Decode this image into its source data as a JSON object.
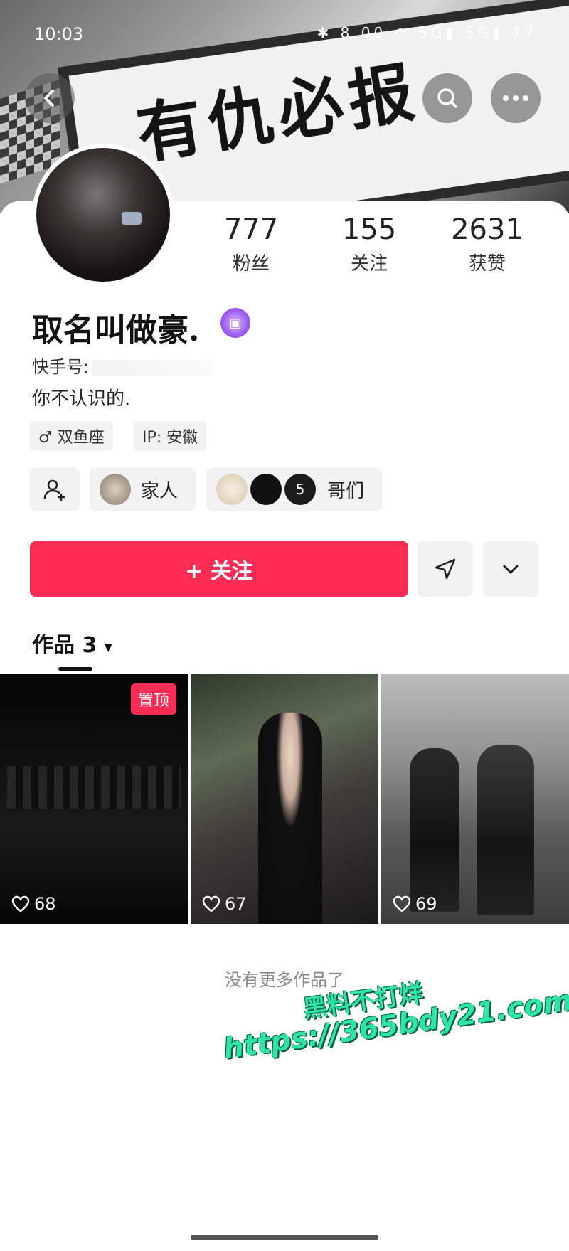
{
  "status_bar": {
    "time": "10:03",
    "icons": "✱ 8.00 ◠ 5G▮ 5G▮ 77"
  },
  "header": {
    "back_icon": "chevron-left-icon",
    "search_icon": "search-icon",
    "more_icon": "more-icon",
    "banner_text": "有仇必报"
  },
  "stats": [
    {
      "value": "777",
      "label": "粉丝"
    },
    {
      "value": "155",
      "label": "关注"
    },
    {
      "value": "2631",
      "label": "获赞"
    }
  ],
  "profile": {
    "name": "取名叫做豪.",
    "id_label": "快手号:",
    "bio": "你不认识的.",
    "tags": [
      "♂ 双鱼座",
      "IP: 安徽"
    ]
  },
  "relations": {
    "family_label": "家人",
    "bros_count": "5",
    "bros_label": "哥们"
  },
  "actions": {
    "follow_label": "+ 关注"
  },
  "works": {
    "title": "作品 3",
    "caret": "▾"
  },
  "posts": [
    {
      "likes": "68",
      "pinned_label": "置顶"
    },
    {
      "likes": "67"
    },
    {
      "likes": "69"
    }
  ],
  "footer": {
    "no_more": "没有更多作品了"
  },
  "watermark": {
    "line1": "黑料不打烊",
    "line2": "https://365bdy21.com"
  },
  "colors": {
    "accent": "#fe2c55",
    "watermark": "#2ee6a4"
  }
}
